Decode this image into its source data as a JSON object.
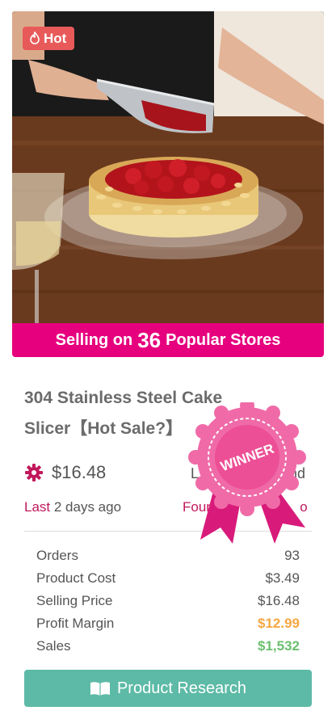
{
  "product": {
    "badge_label": "Hot",
    "stores_prefix": "Selling on",
    "stores_count": "36",
    "stores_suffix": "Popular Stores",
    "title": "304 Stainless Steel Cake Slicer【Hot Sale?】",
    "price": "$16.48",
    "found_partial_left": "L",
    "found_partial_right": "nd",
    "last_label": "Last",
    "last_value": "2 days ago",
    "found_label": "Found",
    "found_tail": "o",
    "winner_label": "WINNER"
  },
  "stats": [
    {
      "label": "Orders",
      "value": "93",
      "style": "normal"
    },
    {
      "label": "Product Cost",
      "value": "$3.49",
      "style": "normal"
    },
    {
      "label": "Selling Price",
      "value": "$16.48",
      "style": "normal"
    },
    {
      "label": "Profit Margin",
      "value": "$12.99",
      "style": "orange"
    },
    {
      "label": "Sales",
      "value": "$1,532",
      "style": "green"
    }
  ],
  "actions": {
    "research_label": "Product Research"
  },
  "colors": {
    "brand_pink": "#e6007e",
    "hot_red": "#e85a5a",
    "button_teal": "#5dbaa6",
    "profit_orange": "#f5a742",
    "sales_green": "#6cbf6f"
  },
  "icons": [
    "flame-icon",
    "gear-icon",
    "book-icon",
    "winner-ribbon-icon"
  ]
}
